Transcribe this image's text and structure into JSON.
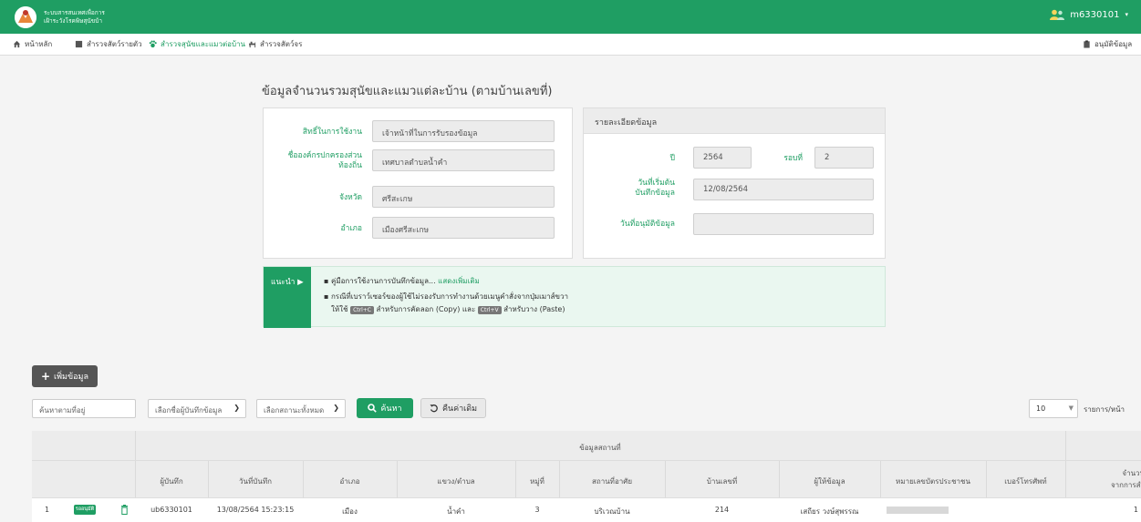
{
  "header": {
    "brand_line1": "ระบบสารสนเทศเพื่อการ",
    "brand_line2": "เฝ้าระวังโรคพิษสุนัขบ้า",
    "username": "m6330101",
    "user_caret": "▾",
    "header_color": "#1f9e63"
  },
  "menu": {
    "home": "หน้าหลัก",
    "item2": "สำรวจสัตว์รายตัว",
    "item3": "สำรวจสุนัขและแมวต่อบ้าน",
    "item4": "สำรวจสัตว์จร",
    "approve": "อนุมัติข้อมูล"
  },
  "page": {
    "title": "ข้อมูลจำนวนรวมสุนัขและแมวแต่ละบ้าน (ตามบ้านเลขที่)"
  },
  "form_left": {
    "role_label": "สิทธิ์ในการใช้งาน",
    "role_value": "เจ้าหน้าที่ในการรับรองข้อมูล",
    "org_label_1": "ชื่อองค์กรปกครองส่วน",
    "org_label_2": "ท้องถิ่น",
    "org_value": "เทศบาลตำบลน้ำคำ",
    "province_label": "จังหวัด",
    "province_value": "ศรีสะเกษ",
    "district_label": "อำเภอ",
    "district_value": "เมืองศรีสะเกษ"
  },
  "form_right": {
    "title": "รายละเอียดข้อมูล",
    "year_label": "ปี",
    "year_value": "2564",
    "round_label": "รอบที่",
    "round_value": "2",
    "start_label_1": "วันที่เริ่มต้น",
    "start_label_2": "บันทึกข้อมูล",
    "start_value": "12/08/2564",
    "approve_label": "วันที่อนุมัติข้อมูล",
    "approve_value": ""
  },
  "tip": {
    "tag": "แนะนำ ▶",
    "line1": "▪ คู่มือการใช้งานการบันทึกข้อมูล...",
    "line1_link": "แสดงเพิ่มเติม",
    "line2": "▪ กรณีที่เบราว์เซอร์ของผู้ใช้ไม่รองรับการทำงานด้วยเมนูคำสั่งจากปุ่มเมาส์ขวา",
    "line3_a": "ให้ใช้",
    "key1": "Ctrl+C",
    "line3_b": "สำหรับการคัดลอก (Copy) และ",
    "key2": "Ctrl+V",
    "line3_c": "สำหรับวาง (Paste)"
  },
  "toolbar": {
    "add_label": "เพิ่มข้อมูล",
    "search_placeholder": "ค้นหาตามที่อยู่",
    "recorder_select": "เลือกชื่อผู้บันทึกข้อมูล",
    "status_select": "เลือกสถานะทั้งหมด",
    "search_label": "ค้นหา",
    "reset_label": "คืนค่าเดิม",
    "page_size": "10",
    "per_page": "รายการ/หน้า"
  },
  "table": {
    "group_header": "ข้อมูลสถานที่",
    "columns": [
      "ผู้บันทึก",
      "วันที่บันทึก",
      "อำเภอ",
      "แขวง/ตำบล",
      "หมู่ที่",
      "สถานที่อาศัย",
      "บ้านเลขที่",
      "ผู้ให้ข้อมูล",
      "หมายเลขบัตรประชาชน",
      "เบอร์โทรศัพท์",
      "จำนวน",
      "จากการสำ"
    ],
    "row": {
      "index": "1",
      "badge": "รออนุมัติ",
      "recorder": "ub6330101",
      "date": "13/08/2564 15:23:15",
      "district": "เมือง",
      "subdistrict": "น้ำคำ",
      "moo": "3",
      "place": "บริเวณบ้าน",
      "house_no": "214",
      "informant": "เสถียร วงษ์สุพรรณ",
      "count": "1"
    }
  }
}
